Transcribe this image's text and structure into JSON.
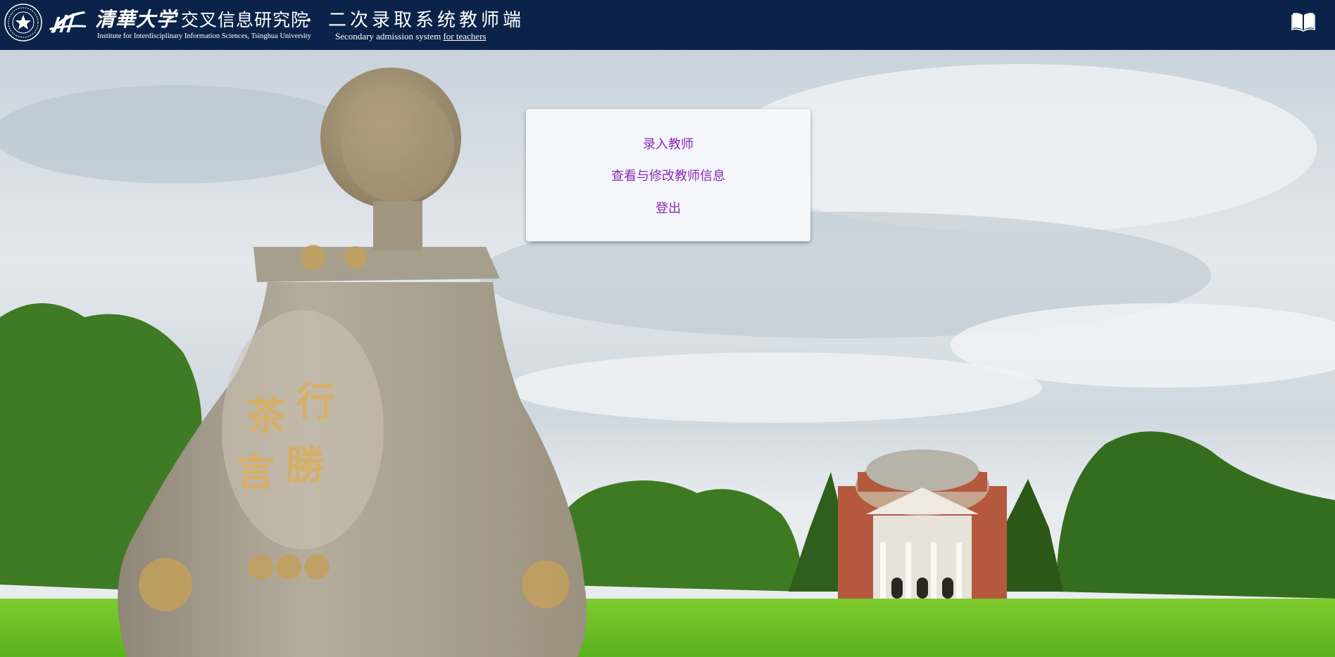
{
  "header": {
    "university_cn": "清華大学",
    "institute_cn": "交叉信息研究院",
    "institute_en": "Institute for Interdisciplinary Information Sciences, Tsinghua University",
    "system_cn": "二次录取系统教师端",
    "system_en_prefix": "Secondary admission system ",
    "system_en_emphasis": "for teachers",
    "bg_color": "#0b2349"
  },
  "menu": {
    "items": [
      {
        "label": "录入教师"
      },
      {
        "label": "查看与修改教师信息"
      },
      {
        "label": "登出"
      }
    ],
    "link_color": "#8a2bb5"
  },
  "icons": {
    "seal": "tsinghua-seal-icon",
    "logo": "iiis-logo-icon",
    "book": "open-book-icon"
  }
}
